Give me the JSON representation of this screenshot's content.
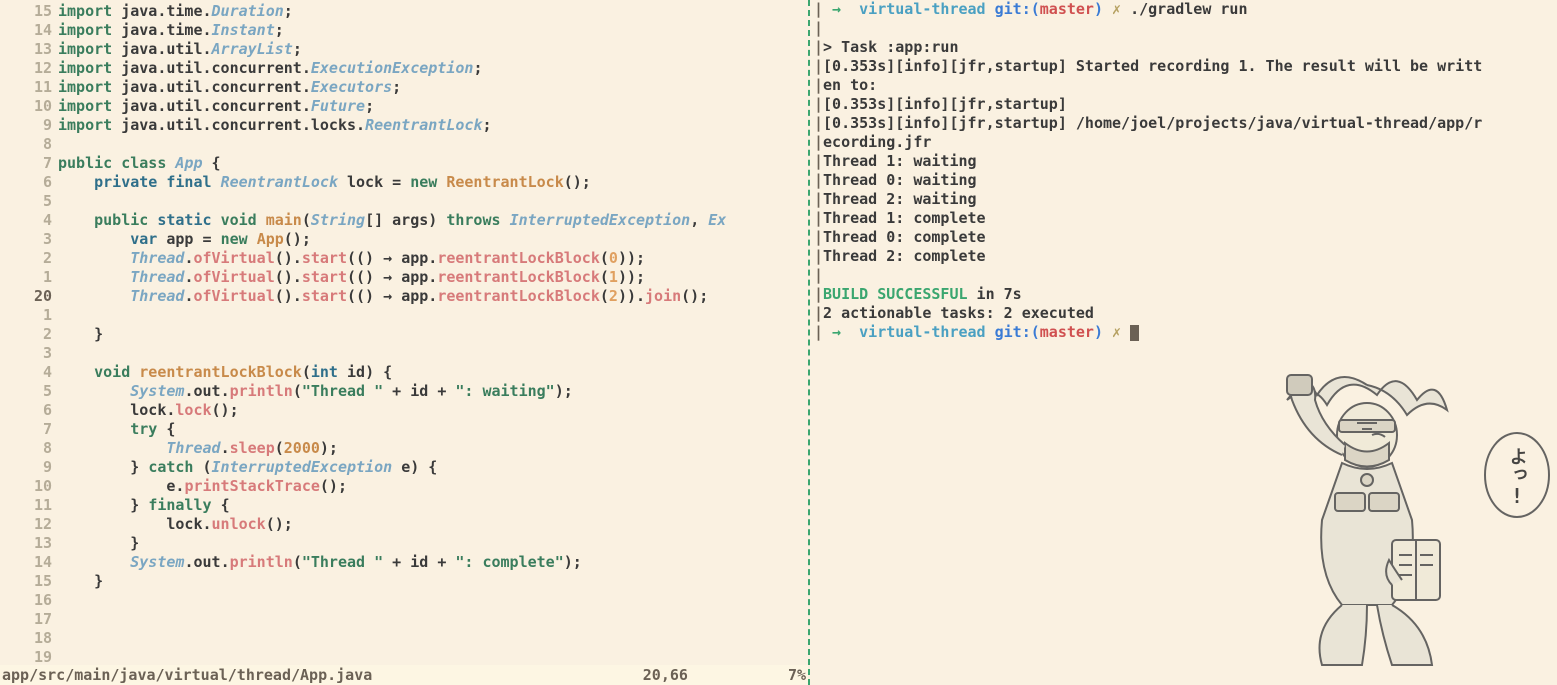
{
  "gutter": [
    "15",
    "14",
    "13",
    "12",
    "11",
    "10",
    "9",
    "8",
    "7",
    "6",
    "5",
    "4",
    "3",
    "2",
    "1",
    "20",
    "1",
    "2",
    "3",
    "4",
    "5",
    "6",
    "7",
    "8",
    "9",
    "10",
    "11",
    "12",
    "13",
    "14",
    "15",
    "16",
    "17",
    "18",
    "19"
  ],
  "gutterCurrentIndex": 15,
  "code": {
    "l0": {
      "imports": [
        {
          "kw": "import",
          "p1": "java",
          "p2": "time",
          "cls": "Duration"
        }
      ]
    },
    "l1": {
      "imports": [
        {
          "kw": "import",
          "p1": "java",
          "p2": "time",
          "cls": "Instant"
        }
      ]
    },
    "l2": {
      "imports": [
        {
          "kw": "import",
          "p1": "java",
          "p2": "util",
          "cls": "ArrayList"
        }
      ]
    },
    "l3": {
      "imports": [
        {
          "kw": "import",
          "p1": "java",
          "p2": "util",
          "p3": "concurrent",
          "cls": "ExecutionException"
        }
      ]
    },
    "l4": {
      "imports": [
        {
          "kw": "import",
          "p1": "java",
          "p2": "util",
          "p3": "concurrent",
          "cls": "Executors"
        }
      ]
    },
    "l5": {
      "imports": [
        {
          "kw": "import",
          "p1": "java",
          "p2": "util",
          "p3": "concurrent",
          "cls": "Future"
        }
      ]
    },
    "l6": {
      "imports": [
        {
          "kw": "import",
          "p1": "java",
          "p2": "util",
          "p3": "concurrent",
          "p4": "locks",
          "cls": "ReentrantLock"
        }
      ]
    },
    "blank": "",
    "classDecl": {
      "kw1": "public",
      "kw2": "class",
      "name": "App",
      "brace": "{"
    },
    "field": {
      "kw1": "private",
      "kw2": "final",
      "type": "ReentrantLock",
      "name": "lock",
      "eq": "=",
      "kw3": "new",
      "ctor": "ReentrantLock",
      "tail": "();"
    },
    "main": {
      "kw1": "public",
      "kw2": "static",
      "kw3": "void",
      "name": "main",
      "args_open": "(",
      "argtype": "String",
      "brackets": "[]",
      "argname": "args",
      "args_close": ")",
      "kw4": "throws",
      "exc": "InterruptedException",
      "comma": ",",
      "exc2": "Ex"
    },
    "varapp": {
      "kw": "var",
      "name": "app",
      "eq": "=",
      "kw2": "new",
      "ctor": "App",
      "tail": "();"
    },
    "t0": {
      "cls": "Thread",
      "m1": "ofVirtual",
      "m2": "start",
      "arrow": "→",
      "obj": "app",
      "m3": "reentrantLockBlock",
      "arg": "0",
      "tail": ");"
    },
    "t1": {
      "cls": "Thread",
      "m1": "ofVirtual",
      "m2": "start",
      "arrow": "→",
      "obj": "app",
      "m3": "reentrantLockBlock",
      "arg": "1",
      "tail": ");"
    },
    "t2": {
      "cls": "Thread",
      "m1": "ofVirtual",
      "m2": "start",
      "arrow": "→",
      "obj": "app",
      "m3": "reentrantLockBlock",
      "arg": "2",
      "m4": "join",
      "tail": "();"
    },
    "brace_close": "}",
    "method": {
      "kw": "void",
      "name": "reentrantLockBlock",
      "argtype": "int",
      "argname": "id",
      "tail": ") {"
    },
    "sout1": {
      "obj": "System",
      "f": "out",
      "m": "println",
      "s1": "\"Thread \"",
      "plus": "+",
      "v": "id",
      "s2": "\": waiting\"",
      "tail": ");"
    },
    "locklock": {
      "obj": "lock",
      "m": "lock",
      "tail": "();"
    },
    "try": "try {",
    "sleep": {
      "cls": "Thread",
      "m": "sleep",
      "arg": "2000",
      "tail": ");"
    },
    "catch": {
      "kw": "catch",
      "type": "InterruptedException",
      "var": "e",
      "tail": ") {"
    },
    "pst": {
      "obj": "e",
      "m": "printStackTrace",
      "tail": "();"
    },
    "finally": "finally {",
    "unlock": {
      "obj": "lock",
      "m": "unlock",
      "tail": "();"
    },
    "sout2": {
      "obj": "System",
      "f": "out",
      "m": "println",
      "s1": "\"Thread \"",
      "plus": "+",
      "v": "id",
      "s2": "\": complete\"",
      "tail": ");"
    }
  },
  "statusline": {
    "path": "app/src/main/java/virtual/thread/App.java",
    "pos": "20,66",
    "pct": "7%"
  },
  "terminal": {
    "prompt1": {
      "arrow": "→",
      "dir": "virtual-thread",
      "git": "git:(",
      "branch": "master",
      "gitc": ")",
      "x": "✗",
      "cmd": "./gradlew run"
    },
    "lines": [
      "",
      "> Task :app:run",
      "[0.353s][info][jfr,startup] Started recording 1. The result will be writt",
      "en to:",
      "[0.353s][info][jfr,startup]",
      "[0.353s][info][jfr,startup] /home/joel/projects/java/virtual-thread/app/r",
      "ecording.jfr",
      "Thread 1: waiting",
      "Thread 0: waiting",
      "Thread 2: waiting",
      "Thread 1: complete",
      "Thread 0: complete",
      "Thread 2: complete",
      ""
    ],
    "build": {
      "succ": "BUILD SUCCESSFUL",
      "rest": " in 7s"
    },
    "tasks": "2 actionable tasks: 2 executed",
    "prompt2": {
      "arrow": "→",
      "dir": "virtual-thread",
      "git": "git:(",
      "branch": "master",
      "gitc": ")",
      "x": "✗"
    }
  }
}
